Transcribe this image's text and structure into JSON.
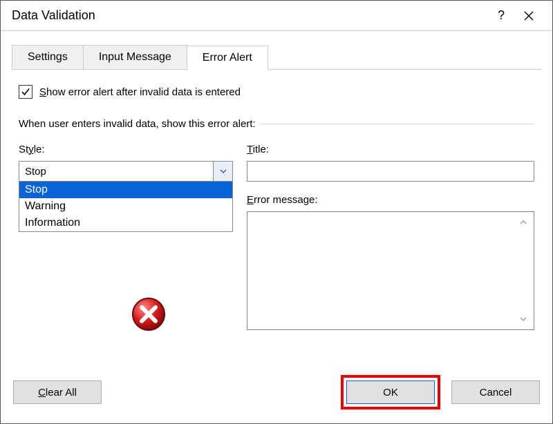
{
  "window": {
    "title": "Data Validation"
  },
  "tabs": {
    "settings": "Settings",
    "input_message": "Input Message",
    "error_alert": "Error Alert"
  },
  "pane": {
    "show_alert_label": {
      "underlined": "S",
      "rest": "how error alert after invalid data is entered"
    },
    "show_alert_checked": true,
    "section_text": "When user enters invalid data, show this error alert:",
    "style_label": {
      "underlined": "y",
      "pre": "St",
      "post": "le:"
    },
    "style_value": "Stop",
    "style_options": [
      "Stop",
      "Warning",
      "Information"
    ],
    "title_label": {
      "underlined": "T",
      "rest": "itle:"
    },
    "title_value": "",
    "error_msg_label": {
      "underlined": "E",
      "rest": "rror message:"
    },
    "error_msg_value": ""
  },
  "footer": {
    "clear_all": {
      "underlined": "C",
      "rest": "lear All"
    },
    "ok": "OK",
    "cancel": "Cancel"
  }
}
